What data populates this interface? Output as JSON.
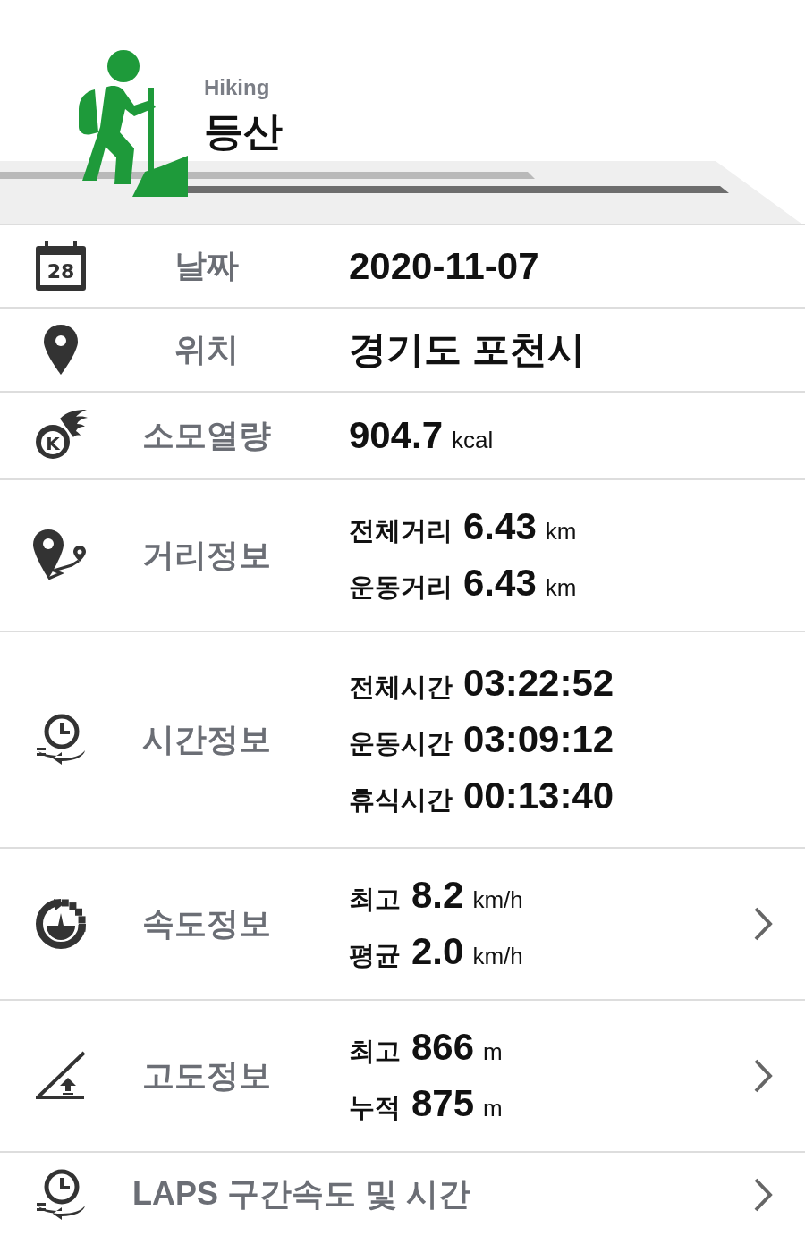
{
  "header": {
    "subtitle": "Hiking",
    "title": "등산"
  },
  "rows": [
    {
      "kind": "single",
      "icon_text": "28",
      "label": "날짜",
      "value": "2020-11-07",
      "has_detail": false
    },
    {
      "kind": "single",
      "label": "위치",
      "value": "경기도 포천시",
      "has_detail": false
    },
    {
      "kind": "single",
      "icon_text": "K",
      "label": "소모열량",
      "value": "904.7",
      "unit": "kcal",
      "has_detail": false
    },
    {
      "kind": "lines",
      "label": "거리정보",
      "has_detail": false,
      "lines": [
        {
          "name": "전체거리",
          "value": "6.43",
          "unit": "km"
        },
        {
          "name": "운동거리",
          "value": "6.43",
          "unit": "km"
        }
      ]
    },
    {
      "kind": "lines",
      "label": "시간정보",
      "has_detail": false,
      "lines": [
        {
          "name": "전체시간",
          "value": "03:22:52"
        },
        {
          "name": "운동시간",
          "value": "03:09:12"
        },
        {
          "name": "휴식시간",
          "value": "00:13:40"
        }
      ]
    },
    {
      "kind": "lines",
      "label": "속도정보",
      "has_detail": true,
      "lines": [
        {
          "name": "최고",
          "value": "8.2",
          "unit": "km/h"
        },
        {
          "name": "평균",
          "value": "2.0",
          "unit": "km/h"
        }
      ]
    },
    {
      "kind": "lines",
      "label": "고도정보",
      "has_detail": true,
      "lines": [
        {
          "name": "최고",
          "value": "866",
          "unit": "m"
        },
        {
          "name": "누적",
          "value": "875",
          "unit": "m"
        }
      ]
    },
    {
      "kind": "laps",
      "label": "LAPS 구간속도 및 시간",
      "has_detail": true
    }
  ]
}
